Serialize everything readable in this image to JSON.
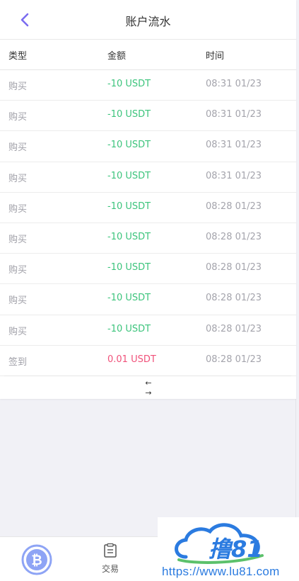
{
  "header": {
    "title": "账户流水"
  },
  "columns": {
    "type": "类型",
    "amount": "金额",
    "time": "时间"
  },
  "rows": [
    {
      "type": "购买",
      "amount": "-10 USDT",
      "time": "08:31 01/23",
      "sign": "neg"
    },
    {
      "type": "购买",
      "amount": "-10 USDT",
      "time": "08:31 01/23",
      "sign": "neg"
    },
    {
      "type": "购买",
      "amount": "-10 USDT",
      "time": "08:31 01/23",
      "sign": "neg"
    },
    {
      "type": "购买",
      "amount": "-10 USDT",
      "time": "08:31 01/23",
      "sign": "neg"
    },
    {
      "type": "购买",
      "amount": "-10 USDT",
      "time": "08:28 01/23",
      "sign": "neg"
    },
    {
      "type": "购买",
      "amount": "-10 USDT",
      "time": "08:28 01/23",
      "sign": "neg"
    },
    {
      "type": "购买",
      "amount": "-10 USDT",
      "time": "08:28 01/23",
      "sign": "neg"
    },
    {
      "type": "购买",
      "amount": "-10 USDT",
      "time": "08:28 01/23",
      "sign": "neg"
    },
    {
      "type": "购买",
      "amount": "-10 USDT",
      "time": "08:28 01/23",
      "sign": "neg"
    },
    {
      "type": "签到",
      "amount": "0.01 USDT",
      "time": "08:28 01/23",
      "sign": "pos"
    }
  ],
  "pager": {
    "prev": "←",
    "next": "→"
  },
  "tabbar": {
    "trade_label": "交易"
  },
  "watermark": {
    "logo_text": "撸81",
    "url": "https://www.lu81.com"
  },
  "colors": {
    "accent": "#7b6cf0",
    "negative_amount": "#3cc47c",
    "positive_amount": "#f0517a",
    "coin": "#8ea4f5",
    "watermark_blue": "#2b7be0"
  },
  "icons": {
    "back": "chevron-left-icon",
    "coin": "bitcoin-icon",
    "trade": "clipboard-list-icon"
  }
}
